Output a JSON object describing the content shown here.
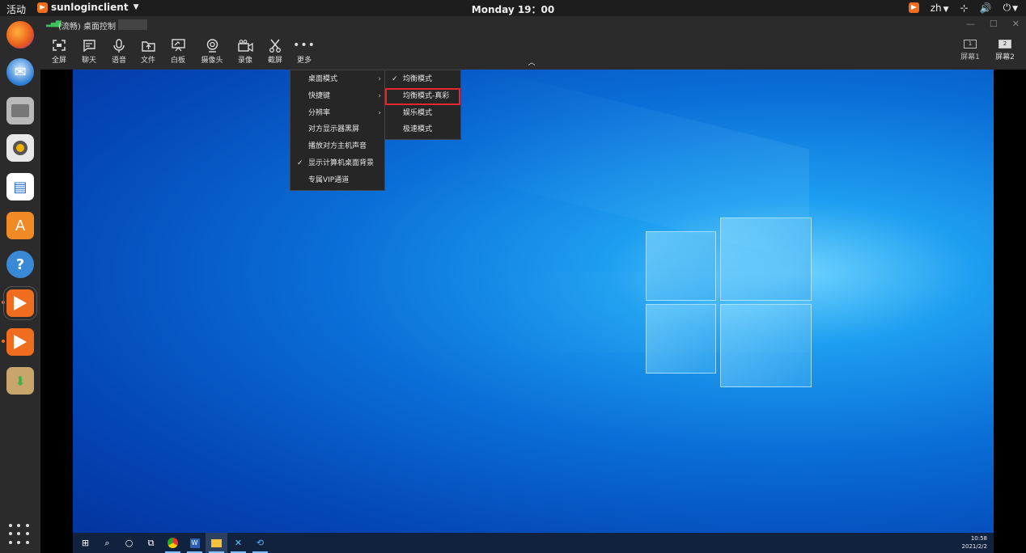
{
  "topbar": {
    "activities": "活动",
    "app_name": "sunloginclient",
    "clock": "Monday 19：00",
    "lang": "zh"
  },
  "window": {
    "title": "(流畅) 桌面控制",
    "controls": {
      "minimize": "—",
      "maximize": "☐",
      "close": "✕"
    }
  },
  "toolbar": {
    "items": [
      {
        "label": "全屏",
        "icon": "fullscreen-icon"
      },
      {
        "label": "聊天",
        "icon": "chat-icon"
      },
      {
        "label": "语音",
        "icon": "microphone-icon"
      },
      {
        "label": "文件",
        "icon": "file-upload-icon"
      },
      {
        "label": "白板",
        "icon": "whiteboard-icon"
      },
      {
        "label": "摄像头",
        "icon": "camera-icon"
      },
      {
        "label": "录像",
        "icon": "video-record-icon"
      },
      {
        "label": "截屏",
        "icon": "scissors-icon"
      },
      {
        "label": "更多",
        "icon": "more-icon"
      }
    ],
    "screens": [
      {
        "num": "1",
        "label": "屏幕1"
      },
      {
        "num": "2",
        "label": "屏幕2"
      }
    ]
  },
  "more_menu": {
    "items": [
      {
        "label": "桌面模式",
        "submenu": true,
        "checked": false
      },
      {
        "label": "快捷键",
        "submenu": true,
        "checked": false
      },
      {
        "label": "分辨率",
        "submenu": true,
        "checked": false
      },
      {
        "label": "对方显示器黑屏",
        "submenu": false,
        "checked": false
      },
      {
        "label": "播放对方主机声音",
        "submenu": false,
        "checked": false
      },
      {
        "label": "显示计算机桌面背景",
        "submenu": false,
        "checked": true
      },
      {
        "label": "专属VIP通道",
        "submenu": false,
        "checked": false
      }
    ]
  },
  "desktop_mode_menu": {
    "items": [
      {
        "label": "均衡模式",
        "checked": true,
        "highlighted": false
      },
      {
        "label": "均衡模式-真彩",
        "checked": false,
        "highlighted": true
      },
      {
        "label": "娱乐模式",
        "checked": false,
        "highlighted": false
      },
      {
        "label": "极速模式",
        "checked": false,
        "highlighted": false
      }
    ]
  },
  "remote_taskbar": {
    "time": "10:58",
    "date": "2021/2/2"
  },
  "colors": {
    "accent": "#f06c1e",
    "highlight_border": "#e5262f",
    "signal": "#3ec15b"
  }
}
